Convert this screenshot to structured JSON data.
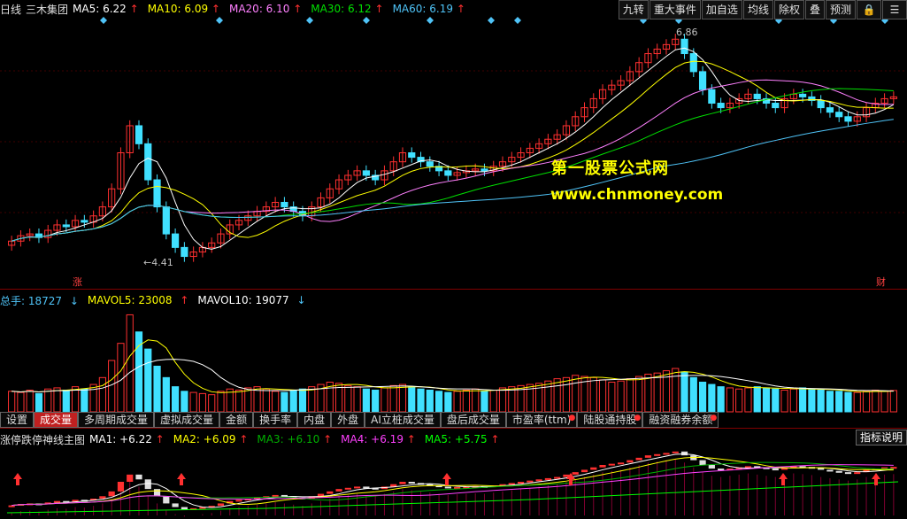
{
  "main": {
    "period": "日线",
    "stock": "三木集团",
    "indicators": [
      {
        "label": "MA5: 6.22",
        "color": "#ffffff"
      },
      {
        "label": "MA10: 6.09",
        "color": "#ffff00"
      },
      {
        "label": "MA20: 6.10",
        "color": "#ff80ff"
      },
      {
        "label": "MA30: 6.12",
        "color": "#00e000"
      },
      {
        "label": "MA60: 6.19",
        "color": "#4fc3f7"
      }
    ],
    "high_label": "6.86",
    "low_label": "←4.41",
    "left_marker": "涨",
    "right_marker": "财",
    "watermark_title": "第一股票公式网",
    "watermark_url": "www.chnmoney.com"
  },
  "toolbar": {
    "items": [
      "九转",
      "重大事件",
      "加自选",
      "均线",
      "除权",
      "叠",
      "预测"
    ],
    "lock_icon": "lock-icon",
    "menu_icon": "menu-icon"
  },
  "volume": {
    "total_label": "总手: 18727",
    "mavol5": "MAVOL5: 23008",
    "mavol10": "MAVOL10: 19077"
  },
  "tabs": [
    {
      "label": "设置",
      "active": false
    },
    {
      "label": "成交量",
      "active": true
    },
    {
      "label": "多周期成交量",
      "active": false
    },
    {
      "label": "虚拟成交量",
      "active": false
    },
    {
      "label": "金额",
      "active": false
    },
    {
      "label": "换手率",
      "active": false
    },
    {
      "label": "内盘",
      "active": false
    },
    {
      "label": "外盘",
      "active": false
    },
    {
      "label": "AI立桩成交量",
      "active": false
    },
    {
      "label": "盘后成交量",
      "active": false
    },
    {
      "label": "市盈率(ttm)",
      "active": false,
      "dot": true
    },
    {
      "label": "陆股通持股",
      "active": false,
      "dot": true
    },
    {
      "label": "融资融券余额",
      "active": false,
      "dot": true
    }
  ],
  "bottom": {
    "title": "涨停跌停神线主图",
    "indicators": [
      {
        "label": "MA1: +6.22",
        "color": "#ffffff"
      },
      {
        "label": "MA2: +6.09",
        "color": "#ffff00"
      },
      {
        "label": "MA3: +6.10",
        "color": "#00b000"
      },
      {
        "label": "MA4: +6.19",
        "color": "#ff40ff"
      },
      {
        "label": "MA5: +5.75",
        "color": "#00ff00"
      }
    ],
    "help_button": "指标说明"
  },
  "chart_data": {
    "type": "candlestick",
    "price_range": [
      4.41,
      6.86
    ],
    "closes": [
      4.62,
      4.68,
      4.7,
      4.66,
      4.74,
      4.8,
      4.78,
      4.85,
      4.83,
      4.9,
      5.0,
      5.2,
      5.6,
      5.9,
      5.7,
      5.3,
      5.0,
      4.7,
      4.55,
      4.45,
      4.5,
      4.55,
      4.6,
      4.7,
      4.8,
      4.85,
      4.9,
      4.95,
      5.0,
      5.05,
      5.0,
      4.95,
      4.9,
      5.0,
      5.1,
      5.2,
      5.3,
      5.35,
      5.4,
      5.35,
      5.3,
      5.4,
      5.5,
      5.6,
      5.55,
      5.5,
      5.45,
      5.4,
      5.35,
      5.38,
      5.4,
      5.42,
      5.4,
      5.45,
      5.5,
      5.55,
      5.6,
      5.65,
      5.7,
      5.75,
      5.8,
      5.9,
      6.0,
      6.1,
      6.2,
      6.3,
      6.35,
      6.4,
      6.5,
      6.6,
      6.7,
      6.75,
      6.8,
      6.86,
      6.7,
      6.5,
      6.3,
      6.15,
      6.1,
      6.15,
      6.2,
      6.25,
      6.2,
      6.15,
      6.1,
      6.2,
      6.25,
      6.22,
      6.18,
      6.1,
      6.05,
      6.0,
      5.95,
      6.0,
      6.1,
      6.15,
      6.2,
      6.22
    ],
    "volumes": [
      18,
      17,
      19,
      16,
      20,
      21,
      19,
      22,
      20,
      24,
      30,
      45,
      60,
      85,
      70,
      55,
      40,
      30,
      22,
      18,
      17,
      16,
      15,
      18,
      20,
      19,
      21,
      22,
      20,
      18,
      17,
      19,
      20,
      22,
      24,
      26,
      25,
      23,
      22,
      20,
      19,
      21,
      23,
      24,
      22,
      20,
      19,
      18,
      17,
      18,
      19,
      20,
      18,
      19,
      21,
      22,
      23,
      24,
      25,
      27,
      29,
      30,
      32,
      31,
      30,
      28,
      26,
      27,
      29,
      31,
      33,
      34,
      36,
      38,
      35,
      30,
      26,
      24,
      22,
      21,
      20,
      21,
      22,
      21,
      20,
      19,
      20,
      21,
      20,
      19,
      18,
      18,
      17,
      17,
      18,
      19,
      18,
      18.7
    ],
    "mavol5": 23008,
    "mavol10": 19077
  }
}
